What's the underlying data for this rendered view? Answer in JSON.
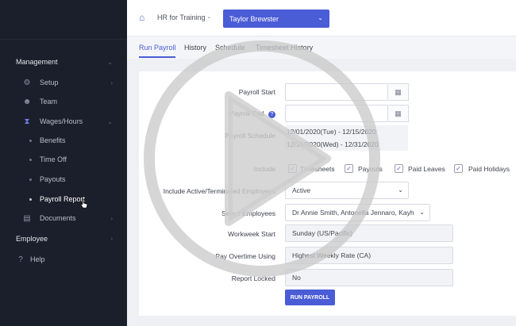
{
  "sidebar": {
    "sections": [
      {
        "label": "Management"
      },
      {
        "label": "Employee"
      }
    ],
    "items": [
      {
        "label": "Setup",
        "icon": "gears-icon"
      },
      {
        "label": "Team",
        "icon": "team-icon"
      },
      {
        "label": "Wages/Hours",
        "icon": "hourglass-icon"
      },
      {
        "label": "Benefits"
      },
      {
        "label": "Time Off"
      },
      {
        "label": "Payouts"
      },
      {
        "label": "Payroll Report"
      },
      {
        "label": "Documents",
        "icon": "document-icon"
      },
      {
        "label": "Help",
        "icon": "help-icon"
      }
    ]
  },
  "header": {
    "company": "HR for Training",
    "employee": "Taylor Brewster"
  },
  "tabs": [
    {
      "label": "Run Payroll"
    },
    {
      "label": "History"
    },
    {
      "label": "Schedule"
    },
    {
      "label": "Timesheet History"
    }
  ],
  "form": {
    "payroll_start_label": "Payroll Start",
    "payroll_end_label": "Payroll End",
    "payroll_schedule_label": "Payroll Schedule",
    "schedule_line1": "12/01/2020(Tue) - 12/15/2020",
    "schedule_line2": "12/16/2020(Wed) - 12/31/2020",
    "include_label": "Include",
    "include_options": [
      {
        "label": "Timesheets",
        "checked": true
      },
      {
        "label": "Payouts",
        "checked": true
      },
      {
        "label": "Paid Leaves",
        "checked": true
      },
      {
        "label": "Paid Holidays",
        "checked": true
      }
    ],
    "active_label": "Include Active/Terminated Employees",
    "active_value": "Active",
    "select_employees_label": "Select Employees",
    "select_employees_value": "Dr Annie Smith, Antonella Jennaro, Kayh",
    "workweek_label": "Workweek Start",
    "workweek_value": "Sunday (US/Pacific)",
    "overtime_label": "Pay Overtime Using",
    "overtime_value": "Highest Weekly Rate (CA)",
    "report_label": "Report Locked",
    "report_value": "No",
    "run_button": "RUN PAYROLL"
  },
  "colors": {
    "accent": "#4a5cd6",
    "sidebar_bg": "#1b1f2b"
  }
}
